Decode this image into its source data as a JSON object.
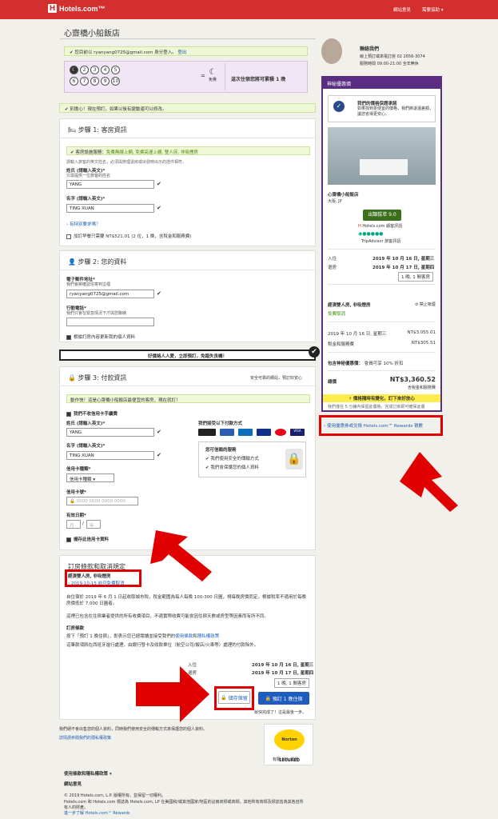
{
  "brand": {
    "name": "Hotels.com™",
    "color": "#d32f2f"
  },
  "topnav": {
    "feedback": "網站意見",
    "help": "需要協助"
  },
  "hotel": {
    "title": "心齋橋小船飯店",
    "name": "心齋橋小船飯店",
    "location": "大阪, JP",
    "rating_badge": "出類拔萃 9.0",
    "rating_source": "Hotels.com 顧客評語",
    "trip_source": "TripAdvisor 旅客評語"
  },
  "signin": {
    "text": "您目前以 ryanyang0725@gmail.com 身分登入。",
    "logout": "登出"
  },
  "rewards": {
    "nights": [
      "1",
      "2",
      "3",
      "4",
      "5",
      "6",
      "7",
      "8",
      "9",
      "10"
    ],
    "eq": "=",
    "free": "免費",
    "text": "這次住宿您將可累積 1 晚"
  },
  "notice": {
    "text": "別擔心！現在預訂，如果以後有變動還可以修改。"
  },
  "step1": {
    "title": "步驟 1: 客房資訊",
    "amenities": "客房設施服務：免費無線上網, 免費高速上網, 雙人床, 非吸煙房",
    "amenities_prefix": "客房設施服務：",
    "amenities_values": "免費無線上網, 免費高速上網, 雙人床, 非吸煙房",
    "hint": "請輸入旅客的英文姓名，必須與辦理退房或出發時出示的證件相符。",
    "last_label": "姓氏 (請輸入英文)*",
    "last_sub": "只需提供一位旅客的姓名",
    "last_value": "YANG",
    "first_label": "名字 (請輸入英文)*",
    "first_value": "TING XUAN",
    "special": "有特別要求嗎？",
    "breakfast": "加訂早餐只需要 NT$521.01 (2 位，1 晚，含稅金和服務費)"
  },
  "step2": {
    "title": "步驟 2: 您的資料",
    "email_label": "電子郵件地址*",
    "email_sub": "我們會將確認信寄到這裡",
    "email_value": "ryanyang0725@gmail.com",
    "phone_label": "行動電話*",
    "phone_sub": "我們只會在緊急情況下才與您聯絡",
    "update": "根據訂房內容更新我的個人資料"
  },
  "promo_bar": {
    "text": "好價格人人愛，立即預訂，免錯失良機！"
  },
  "step3": {
    "title": "步驟 3: 付款資訊",
    "secure": "安全可靠的網站，預訂好安心",
    "urgent": "動作快！這是心齋橋小船飯店最便宜的客房，現在就訂！",
    "no_fee": "我們不收信用卡手續費",
    "last_label": "姓氏 (請輸入英文)*",
    "last_value": "YANG",
    "first_label": "名字 (請輸入英文)*",
    "first_value": "TING XUAN",
    "card_type_label": "信用卡種類*",
    "card_type_value": "信用卡種類",
    "card_no_label": "信用卡號*",
    "card_no_placeholder": "0000 0000 0000 0000",
    "expiry_label": "有效日期*",
    "expiry_month": "月",
    "expiry_year": "年",
    "save": "儲存此信用卡資料",
    "accept": "我們接受以下付款方式",
    "cards": [
      "VISA",
      "MC",
      "JCB",
      "AMEX",
      "UnionPay",
      "Diners"
    ],
    "security_title": "您可信賴的服務",
    "security_items": [
      "我們使用安全的傳輸方式",
      "我們會保護您的個人資料"
    ]
  },
  "terms": {
    "title": "訂房條款和取消規定",
    "room": "經濟雙人房, 非吸煙房",
    "cancel": "2019-10-15 前可免費取消",
    "tax_text": "自住宿於 2019 年 6 月 1 日起收取城市稅，稅金範圍為每人每晚 100-300 日圓，視每晚房價而定。根據稅率不適用於每晚房價低於 7,000 日圓者。",
    "tax_text2": "這裡已包含在住宿業者提供的所有收費項目，不適實際收費可能會因住宿天數或房型等因素而有所不同。",
    "policy_title": "訂房條款",
    "policy_text": "按下「預訂 1 晚住宿」，即表示您已經閱讀並接受我們的",
    "policy_link": "使用條款",
    "policy_and": "和",
    "policy_link2": "隱私權政策",
    "policy_text2": "這筆款項將在西班牙進行處理，由銀行發卡及收款單位（航空公司/飯店/火車等）處理的付款除外。",
    "checkin_label": "入住",
    "checkin": "2019 年 10 月 16 日, 星期三",
    "checkout_label": "退房",
    "checkout": "2019 年 10 月 17 日, 星期四",
    "nights": "1 晚, 1 間客房",
    "save_btn": "儲存保留",
    "book_btn": "預訂 1 晚住宿",
    "almost": "就快完成了！這是最後一步。"
  },
  "footer": {
    "note1": "我們絕不會出售您的個人資料，同時我們使用安全的傳輸方式來保護您的個人資料。",
    "note2": "詳情請參閱我們的隱私權政策",
    "terms": "使用條款和隱私權政策",
    "feedback": "網站意見",
    "copyright": "© 2019 Hotels.com, L.P. 版權所有。並保留一切權利。",
    "legal": "Hotels.com 和 Hotels.com 標誌為 Hotels.com, LP 在美國和/或其他國家/地區的註冊商標或商標。其他所有商標及標誌皆為其各自所有人的財產。",
    "more": "進一步了解 Hotels.com™ Rewards",
    "norton": "Norton SECURED",
    "ssl": "有關 SSL 認證"
  },
  "contact": {
    "title": "聯絡我們",
    "text1": "線上預訂或來電訂房 02 2656-3074",
    "text2": "服務時間 09:00-21:00 全年無休"
  },
  "sidebar": {
    "header": "神秘優惠價",
    "price_guarantee_title": "我們的價格保證承諾",
    "price_guarantee_text": "如果找到更便宜的價格，我們將退還差額，讓您省得更安心。",
    "checkin_label": "入住",
    "checkin": "2019 年 10 月 16 日, 星期三",
    "checkout_label": "退房",
    "checkout": "2019 年 10 月 17 日, 星期四",
    "nights": "1 晚, 1 間客房",
    "room": "經濟雙人房, 非吸煙房",
    "nosmoke": "禁止吸煙",
    "free_cancel": "免費取消",
    "date_line": "2019 年 10 月 16 日, 星期三",
    "date_price": "NT$3,055.01",
    "tax_label": "稅金和服務費",
    "tax_price": "NT$305.51",
    "member_label": "包含神秘優惠價：",
    "member_text": "會員可享 10% 折扣",
    "total_label": "總價",
    "total": "NT$3,360.52",
    "total_sub": "含稅金和服務費",
    "price_alert": "價格隨時有變化，訂下來好放心",
    "price_sub": "我們僅在 5 分鐘內保留此價格，完成訂房即可確保此價",
    "rewards_link": "使用優惠券或兌換 Hotels.com™ Rewards 積數"
  }
}
